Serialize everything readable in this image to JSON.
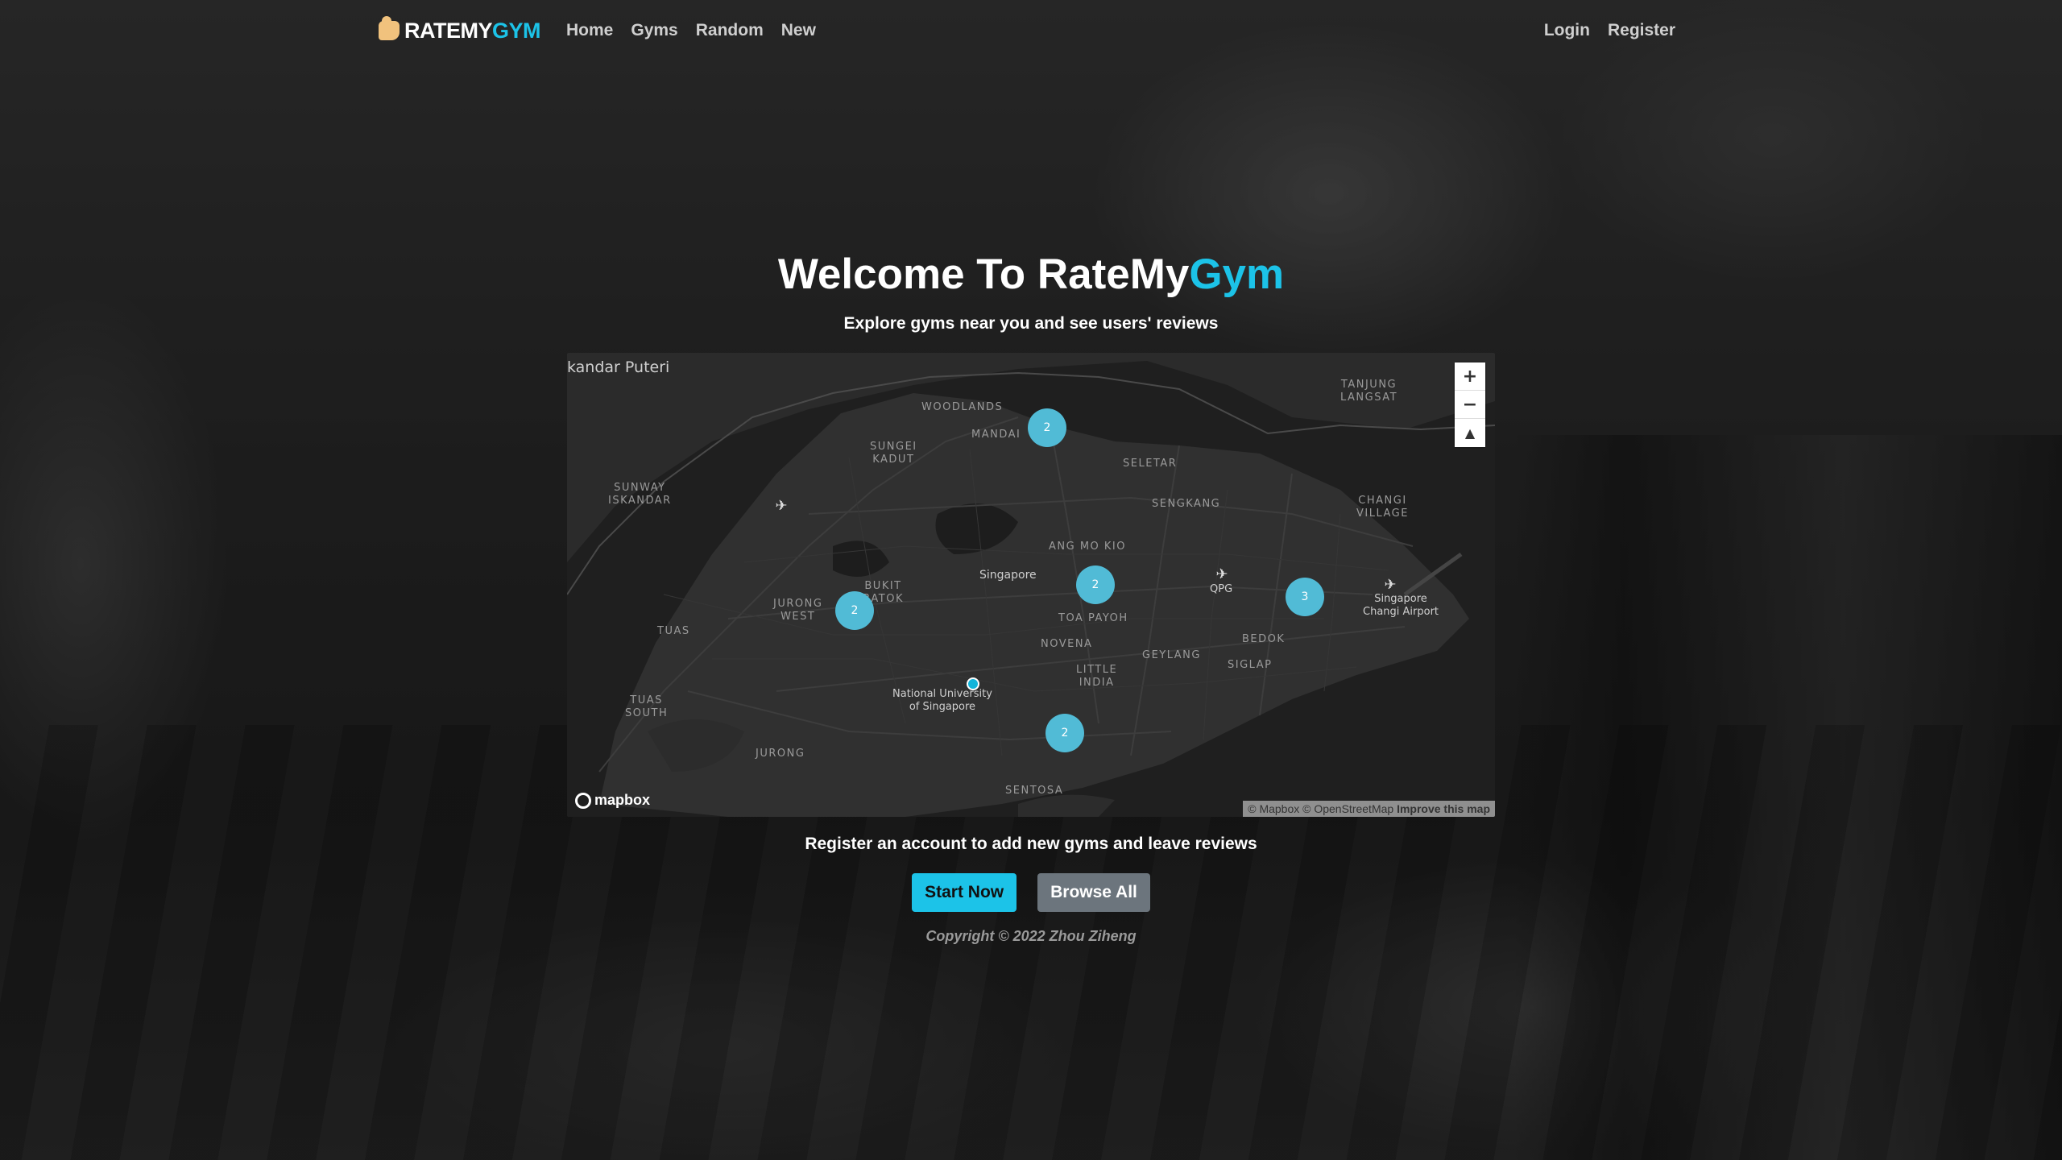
{
  "brand": {
    "text_main": "RATEMY",
    "text_accent": "GYM",
    "logo_icon": "flexed-arm-icon",
    "accent_color": "#1cc3e8"
  },
  "nav": {
    "links": [
      "Home",
      "Gyms",
      "Random",
      "New"
    ],
    "auth": [
      "Login",
      "Register"
    ]
  },
  "hero": {
    "title_main": "Welcome To RateMy",
    "title_accent": "Gym",
    "subtitle": "Explore gyms near you and see users' reviews"
  },
  "map": {
    "labels": {
      "iskandar": "kandar Puteri",
      "woodlands": "WOODLANDS",
      "mandai": "MANDAI",
      "sungei_kadut": "SUNGEI\nKADUT",
      "sunway": "SUNWAY\nISKANDAR",
      "seletar": "SELETAR",
      "sengkang": "SENGKANG",
      "tanjung": "TANJUNG\nLANGSAT",
      "changi_village": "CHANGI\nVILLAGE",
      "ang_mo_kio": "ANG MO KIO",
      "singapore": "Singapore",
      "qpg": "QPG",
      "bukit_batok": "BUKIT\nBATOK",
      "jurong_west": "JURONG\nWEST",
      "toa_payoh": "TOA PAYOH",
      "tuas": "TUAS",
      "novena": "NOVENA",
      "geylang": "GEYLANG",
      "bedok": "BEDOK",
      "siglap": "SIGLAP",
      "changi_airport": "Singapore\nChangi Airport",
      "little_india": "LITTLE\nINDIA",
      "nus": "National University\nof Singapore",
      "tuas_south": "TUAS\nSOUTH",
      "jurong": "JURONG",
      "sentosa": "SENTOSA"
    },
    "clusters": [
      "2",
      "2",
      "2",
      "3",
      "2"
    ],
    "zoom_in": "+",
    "zoom_out": "−",
    "compass": "▲",
    "logo_text": "mapbox",
    "attribution": {
      "mapbox": "© Mapbox",
      "osm": "© OpenStreetMap",
      "improve": "Improve this map"
    },
    "cluster_color": "#51bbd6",
    "point_color": "#11b4da"
  },
  "cta": {
    "text": "Register an account to add new gyms and leave reviews",
    "start_button": "Start Now",
    "browse_button": "Browse All"
  },
  "footer": {
    "copyright": "Copyright © 2022 Zhou Ziheng"
  }
}
